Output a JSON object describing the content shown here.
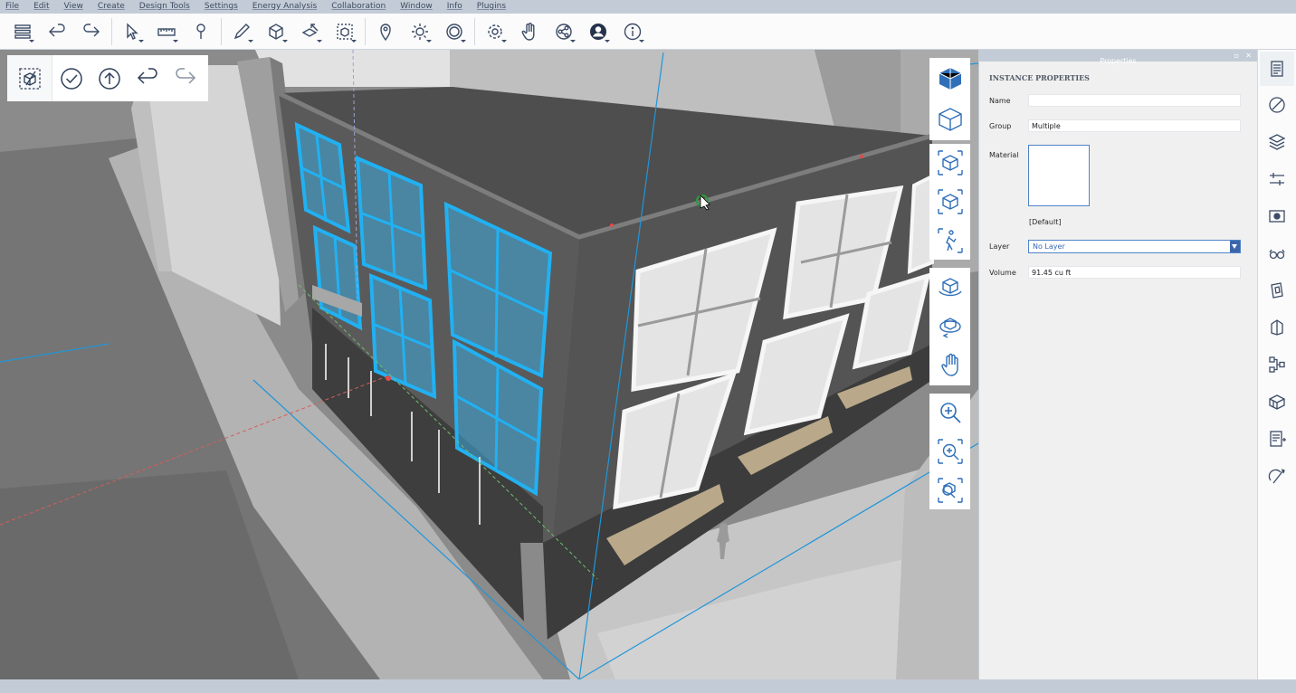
{
  "menu": {
    "items": [
      {
        "label": "File"
      },
      {
        "label": "Edit"
      },
      {
        "label": "View"
      },
      {
        "label": "Create"
      },
      {
        "label": "Design Tools"
      },
      {
        "label": "Settings"
      },
      {
        "label": "Energy Analysis"
      },
      {
        "label": "Collaboration"
      },
      {
        "label": "Window"
      },
      {
        "label": "Info"
      },
      {
        "label": "Plugins"
      }
    ]
  },
  "toolbar": {
    "icons": [
      "browser-icon",
      "undo-icon",
      "redo-icon",
      "select-icon",
      "measure-icon",
      "tape-icon",
      "sketch-icon",
      "primitives-icon",
      "push-pull-icon",
      "group-icon",
      "location-icon",
      "sun-icon",
      "view-360-icon",
      "settings-icon",
      "hand-icon",
      "share-icon",
      "account-icon",
      "info-icon"
    ]
  },
  "editbar": {
    "icons": [
      "edit-group-icon",
      "done-icon",
      "exit-group-icon",
      "undo-icon",
      "redo-icon"
    ]
  },
  "nav": {
    "groups": [
      [
        "viewcube-top-icon",
        "viewcube-bottom-icon"
      ],
      [
        "view-front-icon",
        "view-iso-icon",
        "walk-icon"
      ],
      [
        "orbit-icon",
        "look-around-icon",
        "pan-icon"
      ],
      [
        "zoom-icon",
        "zoom-window-icon",
        "zoom-extents-icon"
      ]
    ]
  },
  "properties": {
    "title": "Properties",
    "section_title": "INSTANCE PROPERTIES",
    "name_label": "Name",
    "name_value": "",
    "group_label": "Group",
    "group_value": "Multiple",
    "material_label": "Material",
    "material_name": "[Default]",
    "layer_label": "Layer",
    "layer_value": "No Layer",
    "volume_label": "Volume",
    "volume_value": "91.45 cu ft"
  },
  "rail": {
    "icons": [
      "properties-icon",
      "materials-icon",
      "layers-icon",
      "settings-icon",
      "scenes-icon",
      "visual-styles-icon",
      "snapshots-icon",
      "bim-icon",
      "analytics-icon",
      "groups-icon",
      "notes-icon",
      "magic-icon"
    ]
  },
  "colors": {
    "selection": "#21b1f2",
    "accent": "#3b66aa",
    "chrome": "#c3ccd6"
  }
}
